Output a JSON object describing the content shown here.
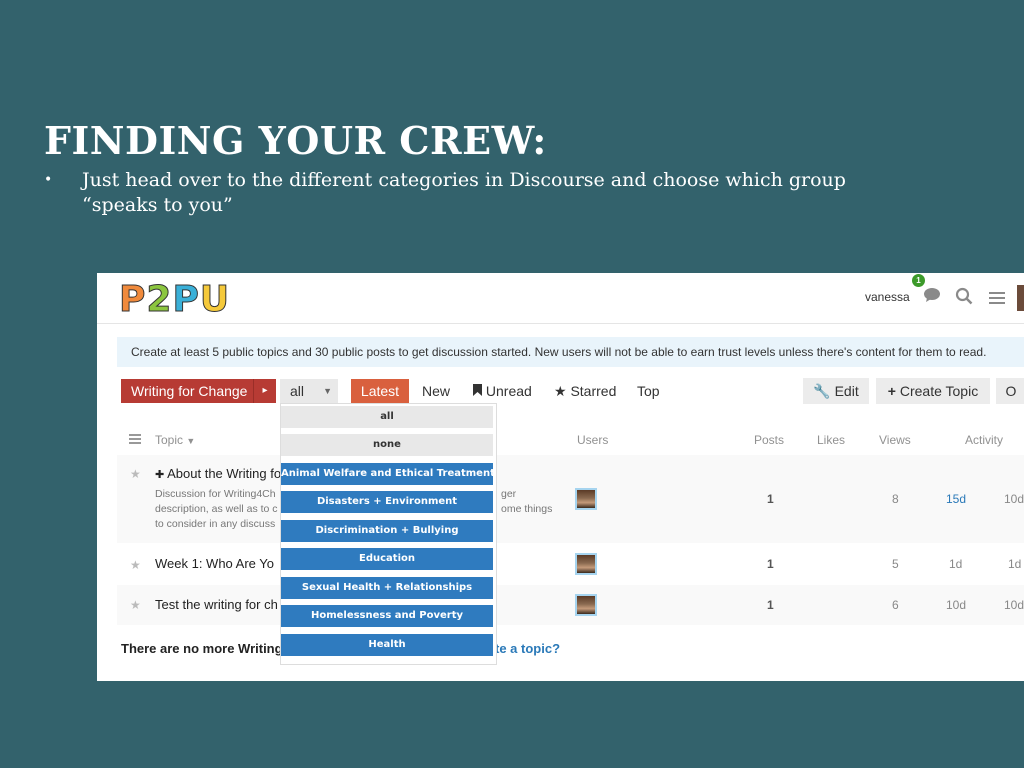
{
  "slide": {
    "title": "FINDING YOUR CREW:",
    "bullet_mark": "•",
    "bullet_text": "Just head over to the different categories in Discourse and choose which group “speaks to you”"
  },
  "header": {
    "logo": [
      "P",
      "2",
      "P",
      "U"
    ],
    "logo_colors": [
      "#f08a3c",
      "#8cc63f",
      "#3ab0d8",
      "#f5c93a"
    ],
    "username": "vanessa",
    "notification_count": "1",
    "icons": [
      "chat-bubble-icon",
      "search-icon",
      "hamburger-menu-icon",
      "user-avatar"
    ]
  },
  "notice": "Create at least 5 public topics and 30 public posts to get discussion started. New users will not be able to earn trust levels unless there's content for them to read.",
  "nav": {
    "category": "Writing for Change",
    "category_arrow": "▸",
    "subcategory": "all",
    "subcategory_caret": "▼",
    "tabs": [
      "Latest",
      "New",
      "Unread",
      "Starred",
      "Top"
    ],
    "edit": "Edit",
    "create_topic": "Create Topic",
    "more": "O"
  },
  "dropdown": {
    "items": [
      "all",
      "none",
      "Animal Welfare and Ethical Treatment",
      "Disasters + Environment",
      "Discrimination + Bullying",
      "Education",
      "Sexual Health + Relationships",
      "Homelessness and Poverty",
      "Health"
    ]
  },
  "table": {
    "headers": [
      "Topic",
      "Users",
      "Posts",
      "Likes",
      "Views",
      "Activity"
    ],
    "rows": [
      {
        "pin": "📌",
        "title": "About the Writing fo",
        "desc_line1": "Discussion for Writing4Ch",
        "desc_line1_end": "ger",
        "desc_line2": "description, as well as to c",
        "desc_line2_end": "ome things",
        "desc_line3": "to consider in any discuss",
        "posts": "1",
        "views": "8",
        "activity1": "15d",
        "activity2": "10d"
      },
      {
        "title": "Week 1: Who Are Yo",
        "posts": "1",
        "views": "5",
        "activity1": "1d",
        "activity2": "1d"
      },
      {
        "title": "Test the writing for ch",
        "posts": "1",
        "views": "6",
        "activity1": "10d",
        "activity2": "10d"
      }
    ]
  },
  "footer": {
    "text": "There are no more Writing",
    "link": "te a topic?"
  }
}
